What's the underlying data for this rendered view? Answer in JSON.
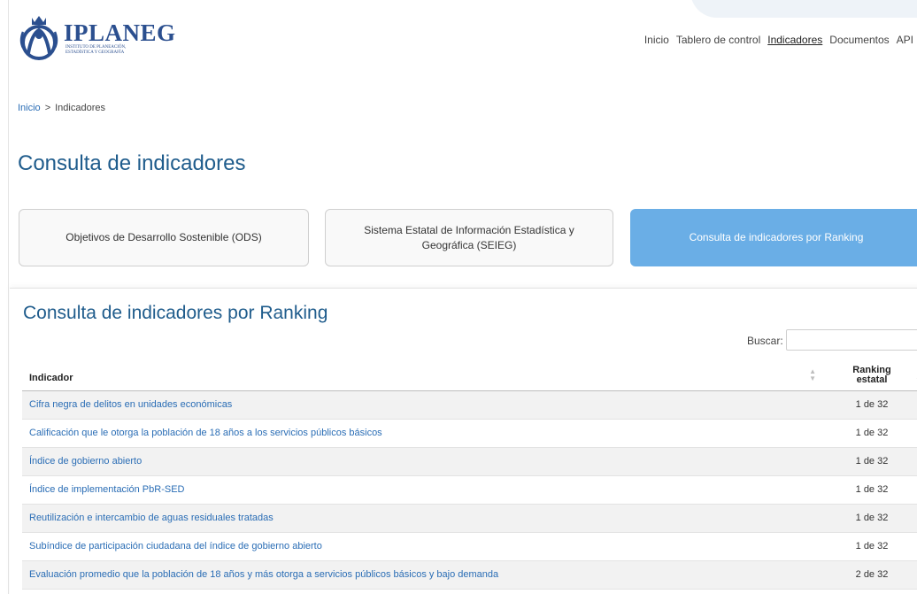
{
  "brand": {
    "name": "IPLANEG",
    "subtitle": "INSTITUTO DE PLANEACIÓN, ESTADÍSTICA Y GEOGRAFÍA"
  },
  "nav": {
    "items": [
      {
        "label": "Inicio"
      },
      {
        "label": "Tablero de control"
      },
      {
        "label": "Indicadores",
        "active": true
      },
      {
        "label": "Documentos"
      },
      {
        "label": "API"
      }
    ]
  },
  "breadcrumb": {
    "home": "Inicio",
    "separator": ">",
    "current": "Indicadores"
  },
  "page": {
    "title": "Consulta de indicadores"
  },
  "tabs": [
    {
      "label": "Objetivos de Desarrollo Sostenible (ODS)"
    },
    {
      "label": "Sistema Estatal de Información Estadística y Geográfica (SEIEG)"
    },
    {
      "label": "Consulta de indicadores por Ranking",
      "active": true
    }
  ],
  "panel": {
    "title": "Consulta de indicadores por Ranking",
    "search_label": "Buscar:",
    "search_value": ""
  },
  "table": {
    "columns": [
      "Indicador",
      "Ranking estatal"
    ],
    "rows": [
      {
        "indicador": "Cifra negra de delitos en unidades económicas",
        "ranking": "1 de 32"
      },
      {
        "indicador": "Calificación que le otorga la población de 18 años a los servicios públicos básicos",
        "ranking": "1 de 32"
      },
      {
        "indicador": "Índice de gobierno abierto",
        "ranking": "1 de 32"
      },
      {
        "indicador": "Índice de implementación PbR-SED",
        "ranking": "1 de 32"
      },
      {
        "indicador": "Reutilización e intercambio de aguas residuales tratadas",
        "ranking": "1 de 32"
      },
      {
        "indicador": "Subíndice de participación ciudadana del índice de gobierno abierto",
        "ranking": "1 de 32"
      },
      {
        "indicador": "Evaluación promedio que la población de 18 años y más otorga a servicios públicos básicos y bajo demanda",
        "ranking": "2 de 32"
      }
    ]
  },
  "colors": {
    "accent": "#6aaee6",
    "title": "#1f5c8c",
    "link": "#2a6db5",
    "brand": "#2b4f8f"
  }
}
